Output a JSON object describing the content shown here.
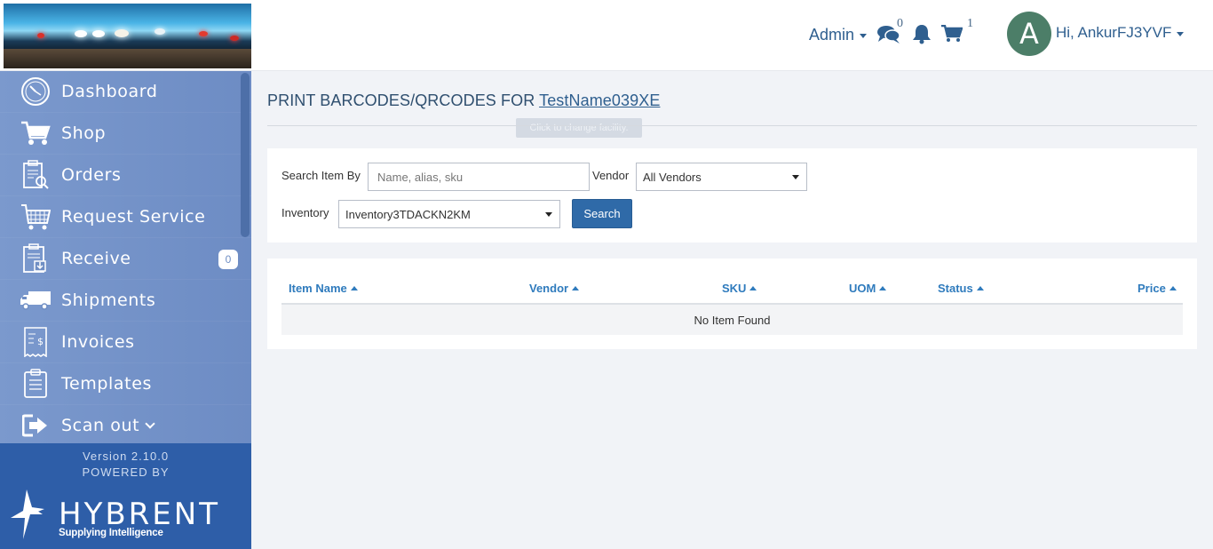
{
  "header": {
    "admin_label": "Admin",
    "messages_count": "0",
    "cart_count": "1",
    "avatar_initial": "A",
    "user_greeting": "Hi, AnkurFJ3YVF"
  },
  "sidebar": {
    "items": [
      {
        "label": "Dashboard",
        "icon": "dashboard-icon"
      },
      {
        "label": "Shop",
        "icon": "cart-icon"
      },
      {
        "label": "Orders",
        "icon": "orders-icon"
      },
      {
        "label": "Request Service",
        "icon": "request-service-icon"
      },
      {
        "label": "Receive",
        "icon": "receive-icon",
        "badge": "0"
      },
      {
        "label": "Shipments",
        "icon": "truck-icon"
      },
      {
        "label": "Invoices",
        "icon": "invoice-icon"
      },
      {
        "label": "Templates",
        "icon": "templates-icon"
      },
      {
        "label": "Scan out",
        "icon": "scan-out-icon"
      }
    ],
    "version": "Version 2.10.0",
    "powered_by": "POWERED BY",
    "brand_name": "HYBRENT",
    "brand_tagline": "Supplying Intelligence"
  },
  "page": {
    "title_prefix": "PRINT BARCODES/QRCODES FOR",
    "facility_name": "TestName039XE",
    "facility_tooltip": "Click to change facility."
  },
  "search": {
    "search_by_label": "Search Item By",
    "search_placeholder": "Name, alias, sku",
    "vendor_label": "Vendor",
    "vendor_value": "All Vendors",
    "inventory_label": "Inventory",
    "inventory_value": "Inventory3TDACKN2KM",
    "search_button": "Search"
  },
  "table": {
    "columns": [
      "Item Name",
      "Vendor",
      "SKU",
      "UOM",
      "Status",
      "Price"
    ],
    "empty_message": "No Item Found"
  },
  "colors": {
    "sidebar_bg": "#6f8ec4",
    "sidebar_footer": "#2e5ea8",
    "accent": "#2f6aa8",
    "link": "#2f7bbd"
  }
}
